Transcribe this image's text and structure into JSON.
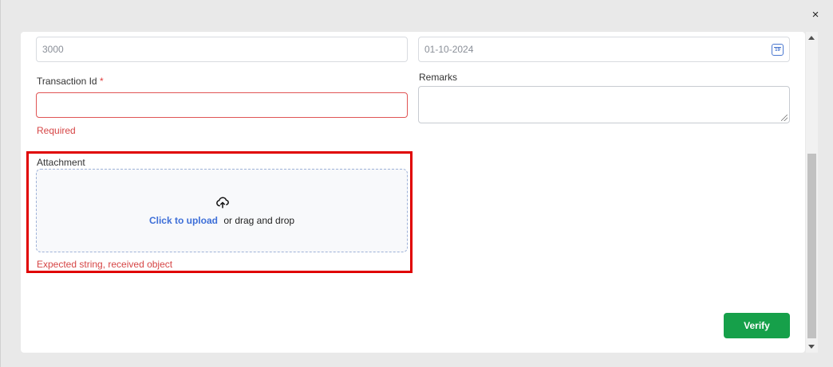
{
  "dialog": {
    "close_glyph": "×"
  },
  "form": {
    "amount": {
      "placeholder": "3000"
    },
    "date": {
      "value": "01-10-2024",
      "calendar_day": "19"
    },
    "transaction_id": {
      "label": "Transaction Id",
      "required_marker": "*",
      "value": "",
      "error": "Required"
    },
    "remarks": {
      "label": "Remarks",
      "value": ""
    },
    "attachment": {
      "label": "Attachment",
      "link_text": "Click to upload",
      "hint_text": "or drag and drop",
      "error": "Expected string, received object"
    }
  },
  "actions": {
    "verify_label": "Verify"
  },
  "colors": {
    "accent_link": "#3e6fd8",
    "error": "#d64545",
    "verify_button": "#16a04a",
    "highlight": "#e00000"
  }
}
